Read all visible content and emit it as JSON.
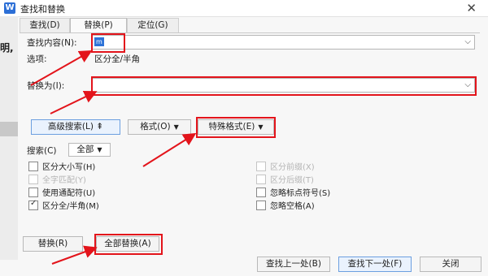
{
  "window": {
    "title": "查找和替换",
    "close_glyph": "✕",
    "icon_letter": "W"
  },
  "background_fragment": "明,",
  "tabs": [
    {
      "label": "查找(D)",
      "active": false
    },
    {
      "label": "替换(P)",
      "active": true
    },
    {
      "label": "定位(G)",
      "active": false
    }
  ],
  "find": {
    "label": "查找内容(N):",
    "value": "m"
  },
  "options": {
    "label": "选项:",
    "value": "区分全/半角"
  },
  "replace": {
    "label": "替换为(I):",
    "value": ""
  },
  "buttons": {
    "advanced": "高级搜索(L) ⇞",
    "format": "格式(O)",
    "special": "特殊格式(E)",
    "replace": "替换(R)",
    "replace_all": "全部替换(A)",
    "find_prev": "查找上一处(B)",
    "find_next": "查找下一处(F)",
    "close": "关闭"
  },
  "search": {
    "label": "搜索(C)",
    "value": "全部"
  },
  "checkboxes_left": [
    {
      "label": "区分大小写(H)",
      "checked": false,
      "disabled": false
    },
    {
      "label": "全字匹配(Y)",
      "checked": false,
      "disabled": true
    },
    {
      "label": "使用通配符(U)",
      "checked": false,
      "disabled": false
    },
    {
      "label": "区分全/半角(M)",
      "checked": true,
      "disabled": false
    }
  ],
  "checkboxes_right": [
    {
      "label": "区分前缀(X)",
      "checked": false,
      "disabled": true
    },
    {
      "label": "区分后缀(T)",
      "checked": false,
      "disabled": true
    },
    {
      "label": "忽略标点符号(S)",
      "checked": false,
      "disabled": false
    },
    {
      "label": "忽略空格(A)",
      "checked": false,
      "disabled": false
    }
  ],
  "colors": {
    "annotation": "#e3141b",
    "selection": "#2e73d8",
    "accent": "#6c9fe0"
  },
  "icons": {
    "dropdown": "chevron-down-icon",
    "check": "checkmark-icon",
    "close": "close-icon",
    "caret": "caret-down-icon"
  }
}
